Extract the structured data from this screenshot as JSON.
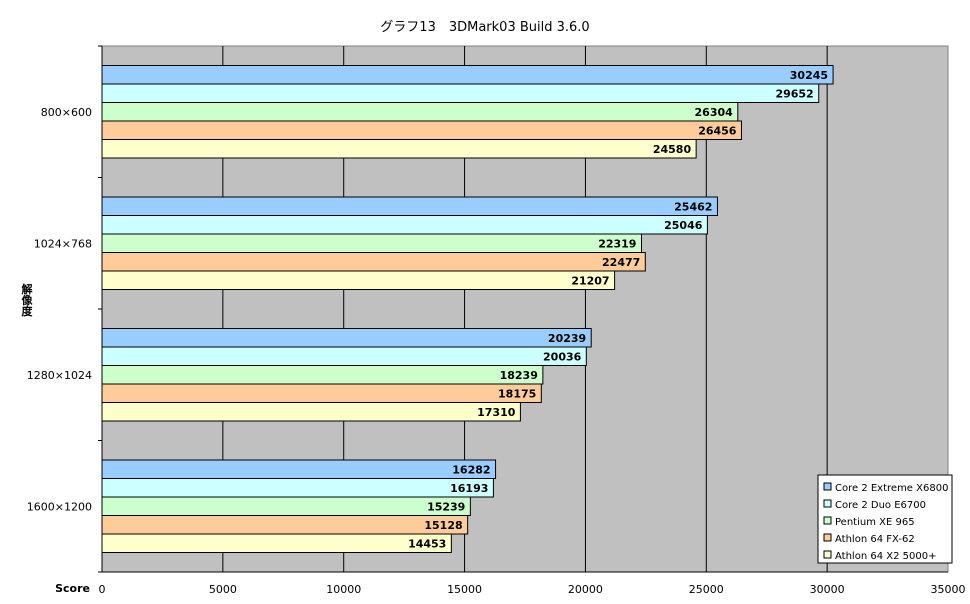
{
  "chart_data": {
    "type": "bar",
    "orientation": "horizontal",
    "title": "グラフ13　3DMark03 Build 3.6.0",
    "xlabel": "Score",
    "ylabel": "解像度",
    "xlim": [
      0,
      35000
    ],
    "xticks": [
      0,
      5000,
      10000,
      15000,
      20000,
      25000,
      30000,
      35000
    ],
    "grid": true,
    "legend_position": "bottom-right",
    "categories": [
      "800×600",
      "1024×768",
      "1280×1024",
      "1600×1200"
    ],
    "series": [
      {
        "name": "Core 2 Extreme X6800",
        "color": "#99ccff",
        "values": [
          30245,
          25462,
          20239,
          16282
        ]
      },
      {
        "name": "Core 2 Duo E6700",
        "color": "#ccffff",
        "values": [
          29652,
          25046,
          20036,
          16193
        ]
      },
      {
        "name": "Pentium XE 965",
        "color": "#ccffcc",
        "values": [
          26304,
          22319,
          18239,
          15239
        ]
      },
      {
        "name": "Athlon 64 FX-62",
        "color": "#ffcc99",
        "values": [
          26456,
          22477,
          18175,
          15128
        ]
      },
      {
        "name": "Athlon 64 X2 5000+",
        "color": "#ffffcc",
        "values": [
          24580,
          21207,
          17310,
          14453
        ]
      }
    ],
    "plot_background": "#c0c0c0"
  }
}
